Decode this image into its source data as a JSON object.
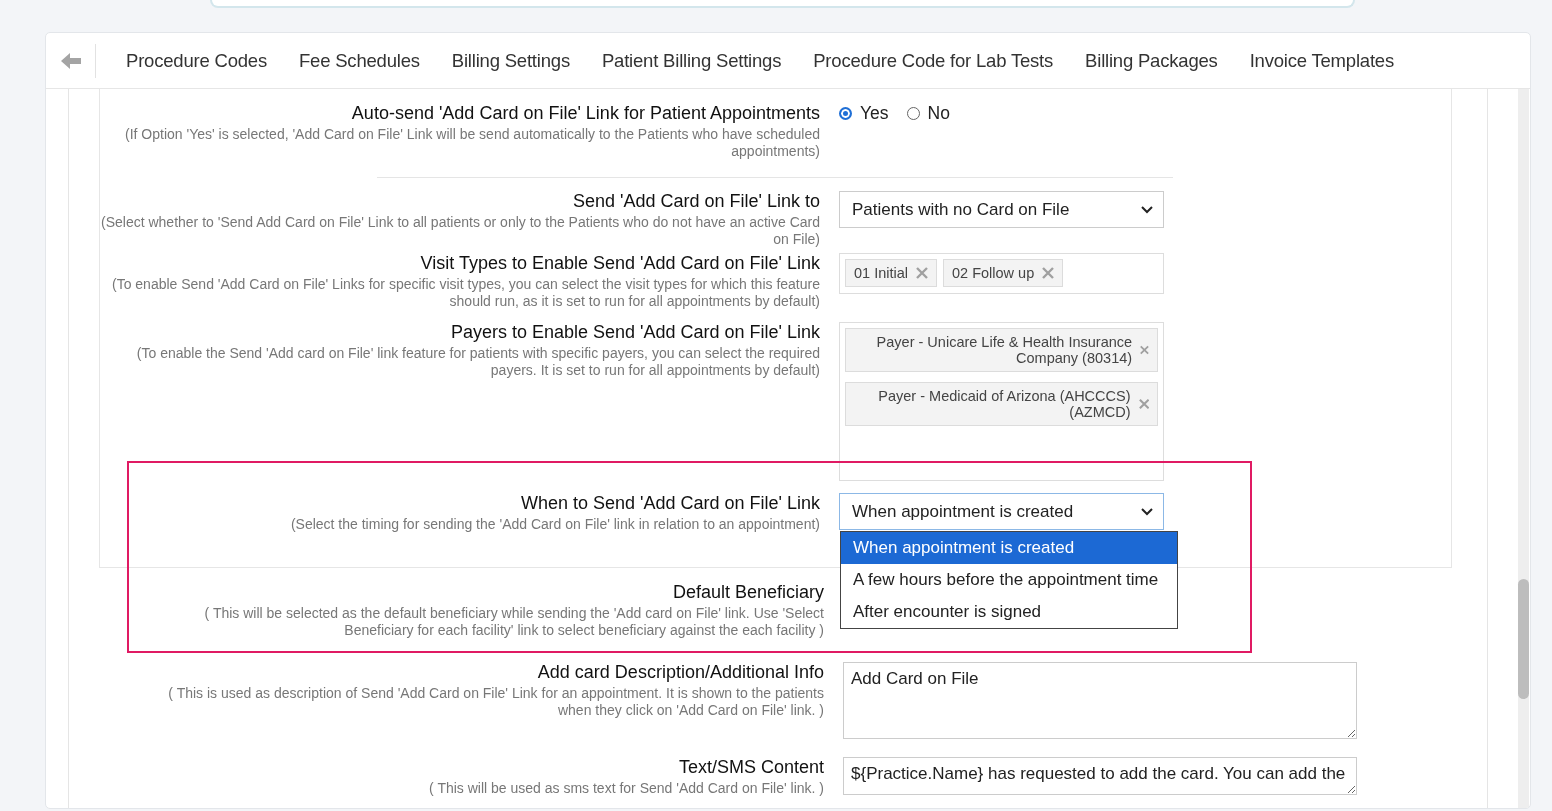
{
  "tabs": [
    {
      "label": "Procedure Codes",
      "selected": false
    },
    {
      "label": "Fee Schedules",
      "selected": false
    },
    {
      "label": "Billing Settings",
      "selected": false
    },
    {
      "label": "Patient Billing Settings",
      "selected": false
    },
    {
      "label": "Procedure Code for Lab Tests",
      "selected": false
    },
    {
      "label": "Billing Packages",
      "selected": false
    },
    {
      "label": "Invoice Templates",
      "selected": false
    }
  ],
  "panel_settings": [
    {
      "kind": "radio",
      "label": "Auto-send 'Add Card on File' Link for Patient Appointments",
      "description": "(If Option 'Yes' is selected, 'Add Card on File' Link will be send automatically to the Patients who have scheduled appointments)",
      "options": [
        {
          "label": "Yes",
          "selected": true
        },
        {
          "label": "No",
          "selected": false
        }
      ]
    },
    {
      "kind": "select",
      "label": "Send 'Add Card on File' Link to",
      "description": "(Select whether to 'Send Add Card on File' Link to all patients or only to the Patients who do not have an active Card on File)",
      "value": "Patients with no Card on File",
      "focused": false
    },
    {
      "kind": "tags",
      "label": "Visit Types to Enable Send 'Add Card on File' Link",
      "description": "(To enable Send 'Add Card on File' Links for specific visit types, you can select the visit types for which this feature should run, as it is set to run for all appointments by default)",
      "tags": [
        "01 Initial",
        "02 Follow up"
      ]
    },
    {
      "kind": "tags",
      "label": "Payers to Enable Send 'Add Card on File' Link",
      "description": "(To enable the Send 'Add card on File' link feature for patients with specific payers, you can select the required payers. It is set to run for all appointments by default)",
      "tags": [
        "Payer - Unicare Life & Health Insurance Company (80314)",
        "Payer - Medicaid of Arizona (AHCCCS) (AZMCD)"
      ]
    },
    {
      "kind": "select",
      "label": "When to Send 'Add Card on File' Link",
      "description": "(Select the timing for sending the 'Add Card on File' link in relation to an appointment)",
      "value": "When appointment is created",
      "focused": true,
      "dropdown": [
        {
          "label": "When appointment is created",
          "selected": true
        },
        {
          "label": "A few hours before the appointment time",
          "selected": false
        },
        {
          "label": "After encounter is signed",
          "selected": false
        }
      ]
    }
  ],
  "settings": [
    {
      "kind": "none",
      "label": "Default Beneficiary",
      "description": "( This will be selected as the default beneficiary while sending the 'Add card on File' link. Use 'Select Beneficiary for each facility' link to select beneficiary against the each facility )"
    },
    {
      "kind": "textarea",
      "label": "Add card Description/Additional Info",
      "description": "( This is used as description of Send 'Add Card on File' Link for an appointment. It is shown to the patients when they click on 'Add Card on File' link. )",
      "value": "Add Card on File"
    },
    {
      "kind": "textarea",
      "label": "Text/SMS Content",
      "description": "( This will be used as sms text for Send 'Add Card on File' link. )",
      "value": "${Practice.Name} has requested to add the card. You can add the"
    }
  ]
}
